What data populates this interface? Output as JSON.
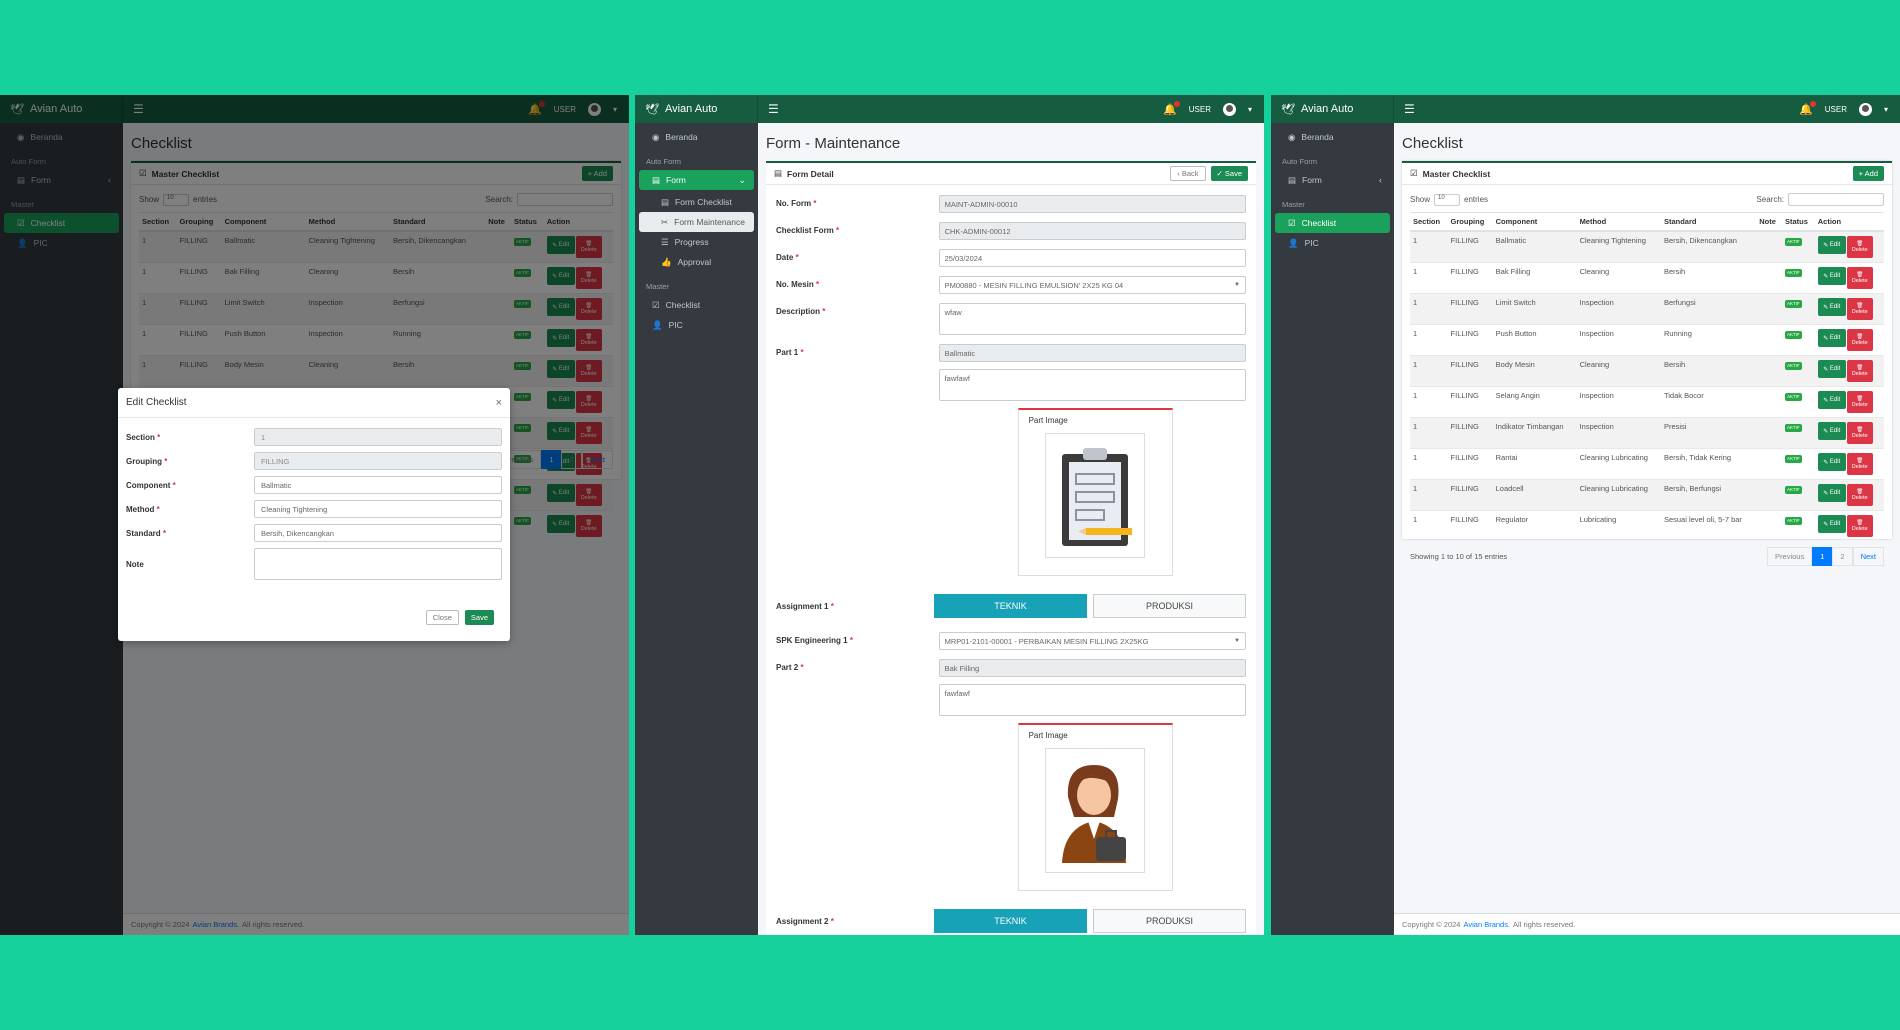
{
  "brand": "Avian Auto",
  "topbar": {
    "user": "USER"
  },
  "sidebar": {
    "home": "Beranda",
    "auto_form_head": "Auto Form",
    "form": "Form",
    "master_head": "Master",
    "checklist": "Checklist",
    "pic": "PIC",
    "form_sub": [
      "Form Checklist",
      "Form Maintenance",
      "Progress",
      "Approval"
    ]
  },
  "checklist_page": {
    "title": "Checklist",
    "card_title": "Master Checklist",
    "add": "+ Add",
    "show": "Show",
    "entries_value": "10",
    "entries": "entries",
    "search": "Search:",
    "columns": [
      "Section",
      "Grouping",
      "Component",
      "Method",
      "Standard",
      "Note",
      "Status",
      "Action"
    ],
    "rows": [
      [
        "1",
        "FILLING",
        "Ballmatic",
        "Cleaning Tightening",
        "Bersih, Dikencangkan",
        ""
      ],
      [
        "1",
        "FILLING",
        "Bak Filling",
        "Cleaning",
        "Bersih",
        ""
      ],
      [
        "1",
        "FILLING",
        "Limit Switch",
        "Inspection",
        "Berfungsi",
        ""
      ],
      [
        "1",
        "FILLING",
        "Push Button",
        "Inspection",
        "Running",
        ""
      ],
      [
        "1",
        "FILLING",
        "Body Mesin",
        "Cleaning",
        "Bersih",
        ""
      ],
      [
        "1",
        "FILLING",
        "Selang Angin",
        "Inspection",
        "Tidak Bocor",
        ""
      ],
      [
        "1",
        "FILLING",
        "Indikator Timbangan",
        "Inspection",
        "Presisi",
        ""
      ],
      [
        "1",
        "FILLING",
        "Rantai",
        "Cleaning Lubricating",
        "Bersih, Tidak Kering",
        ""
      ],
      [
        "1",
        "FILLING",
        "Loadcell",
        "Cleaning Lubricating",
        "Bersih, Berfungsi",
        ""
      ],
      [
        "1",
        "FILLING",
        "Regulator",
        "Lubricating",
        "Sesuai level oli, 5-7 bar",
        ""
      ]
    ],
    "status_label": "AKTIF",
    "edit": "Edit",
    "delete": "Delete",
    "showing": "Showing 1 to 10 of 15 entries",
    "prev": "Previous",
    "page1": "1",
    "page2": "2",
    "next": "Next"
  },
  "modal": {
    "title": "Edit Checklist",
    "close_x": "×",
    "fields": [
      {
        "label": "Section",
        "req": "*",
        "value": "1"
      },
      {
        "label": "Grouping",
        "req": "*",
        "value": "FILLING"
      },
      {
        "label": "Component",
        "req": "*",
        "value": "Ballmatic"
      },
      {
        "label": "Method",
        "req": "*",
        "value": "Cleaning Tightening"
      },
      {
        "label": "Standard",
        "req": "*",
        "value": "Bersih, Dikencangkan"
      },
      {
        "label": "Note",
        "req": "",
        "value": ""
      }
    ],
    "close": "Close",
    "save": "Save"
  },
  "maintenance": {
    "title": "Form - Maintenance",
    "card_title": "Form Detail",
    "back": "Back",
    "save": "Save",
    "no_form_label": "No. Form",
    "no_form": "MAINT-ADMIN-00010",
    "checklist_label": "Checklist Form",
    "checklist": "CHK-ADMIN-00012",
    "date_label": "Date",
    "date": "25/03/2024",
    "mesin_label": "No. Mesin",
    "mesin": "PM00880 - MESIN FILLING EMULSION' 2X25 KG 04",
    "desc_label": "Description",
    "desc": "wfaw",
    "part1_label": "Part 1",
    "part1": "Ballmatic",
    "part1_note": "fawfawf",
    "part_image": "Part Image",
    "assign1_label": "Assignment 1",
    "teknik": "TEKNIK",
    "produksi": "PRODUKSI",
    "spk_label": "SPK Engineering 1",
    "spk": "MRP01-2101-00001 - PERBAIKAN MESIN FILLING 2X25KG",
    "part2_label": "Part 2",
    "part2": "Bak Filling",
    "part2_note": "fawfawf",
    "assign2_label": "Assignment 2",
    "req": "*"
  },
  "footer": {
    "pre": "Copyright © 2024",
    "link": "Avian Brands.",
    "post": "All rights reserved."
  },
  "colors": {
    "topbar": "#155c40",
    "sidebar": "#343a40",
    "accent": "#1aa15c",
    "danger": "#dc3545",
    "info": "#17a2b8",
    "background": "#16d19c"
  }
}
